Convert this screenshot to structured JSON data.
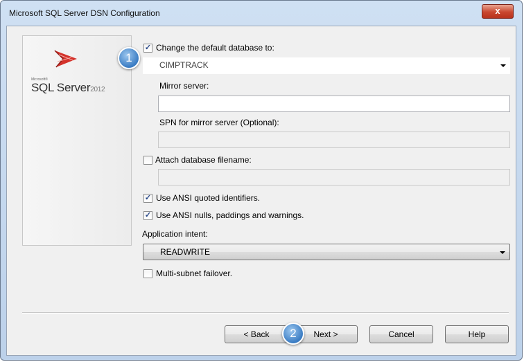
{
  "window": {
    "title": "Microsoft SQL Server DSN Configuration",
    "close_label": "x"
  },
  "logo": {
    "small_text": "Microsoft®",
    "product": "SQL Server",
    "year": "2012"
  },
  "options": {
    "change_default_db": {
      "label": "Change the default database to:",
      "checked": true,
      "value": "CIMPTRACK"
    },
    "mirror_server": {
      "label": "Mirror server:",
      "value": ""
    },
    "spn": {
      "label": "SPN for mirror server (Optional):",
      "value": ""
    },
    "attach_db": {
      "label": "Attach database filename:",
      "checked": false,
      "value": ""
    },
    "ansi_quoted": {
      "label": "Use ANSI quoted identifiers.",
      "checked": true
    },
    "ansi_nulls": {
      "label": "Use ANSI nulls, paddings and warnings.",
      "checked": true
    },
    "app_intent": {
      "label": "Application intent:",
      "value": "READWRITE"
    },
    "multi_subnet": {
      "label": "Multi-subnet failover.",
      "checked": false
    }
  },
  "buttons": {
    "back": "< Back",
    "next": "Next >",
    "cancel": "Cancel",
    "help": "Help"
  },
  "badges": {
    "one": "1",
    "two": "2"
  }
}
